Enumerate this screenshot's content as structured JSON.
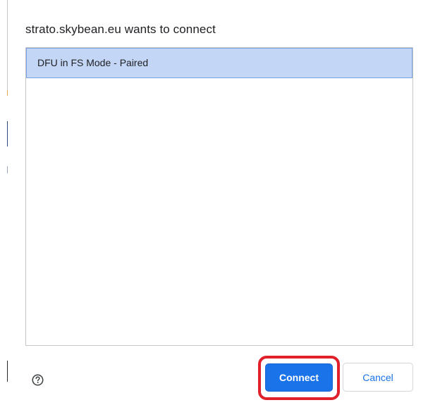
{
  "dialog": {
    "title": "strato.skybean.eu wants to connect",
    "devices": [
      {
        "label": "DFU in FS Mode - Paired",
        "selected": true
      }
    ]
  },
  "footer": {
    "help_icon": "help-circle-icon",
    "connect_label": "Connect",
    "cancel_label": "Cancel"
  },
  "colors": {
    "primary": "#1a73e8",
    "selection_background": "#c3d6f5",
    "selection_border": "#7aa3e6",
    "highlight_annotation": "#e0202a"
  }
}
